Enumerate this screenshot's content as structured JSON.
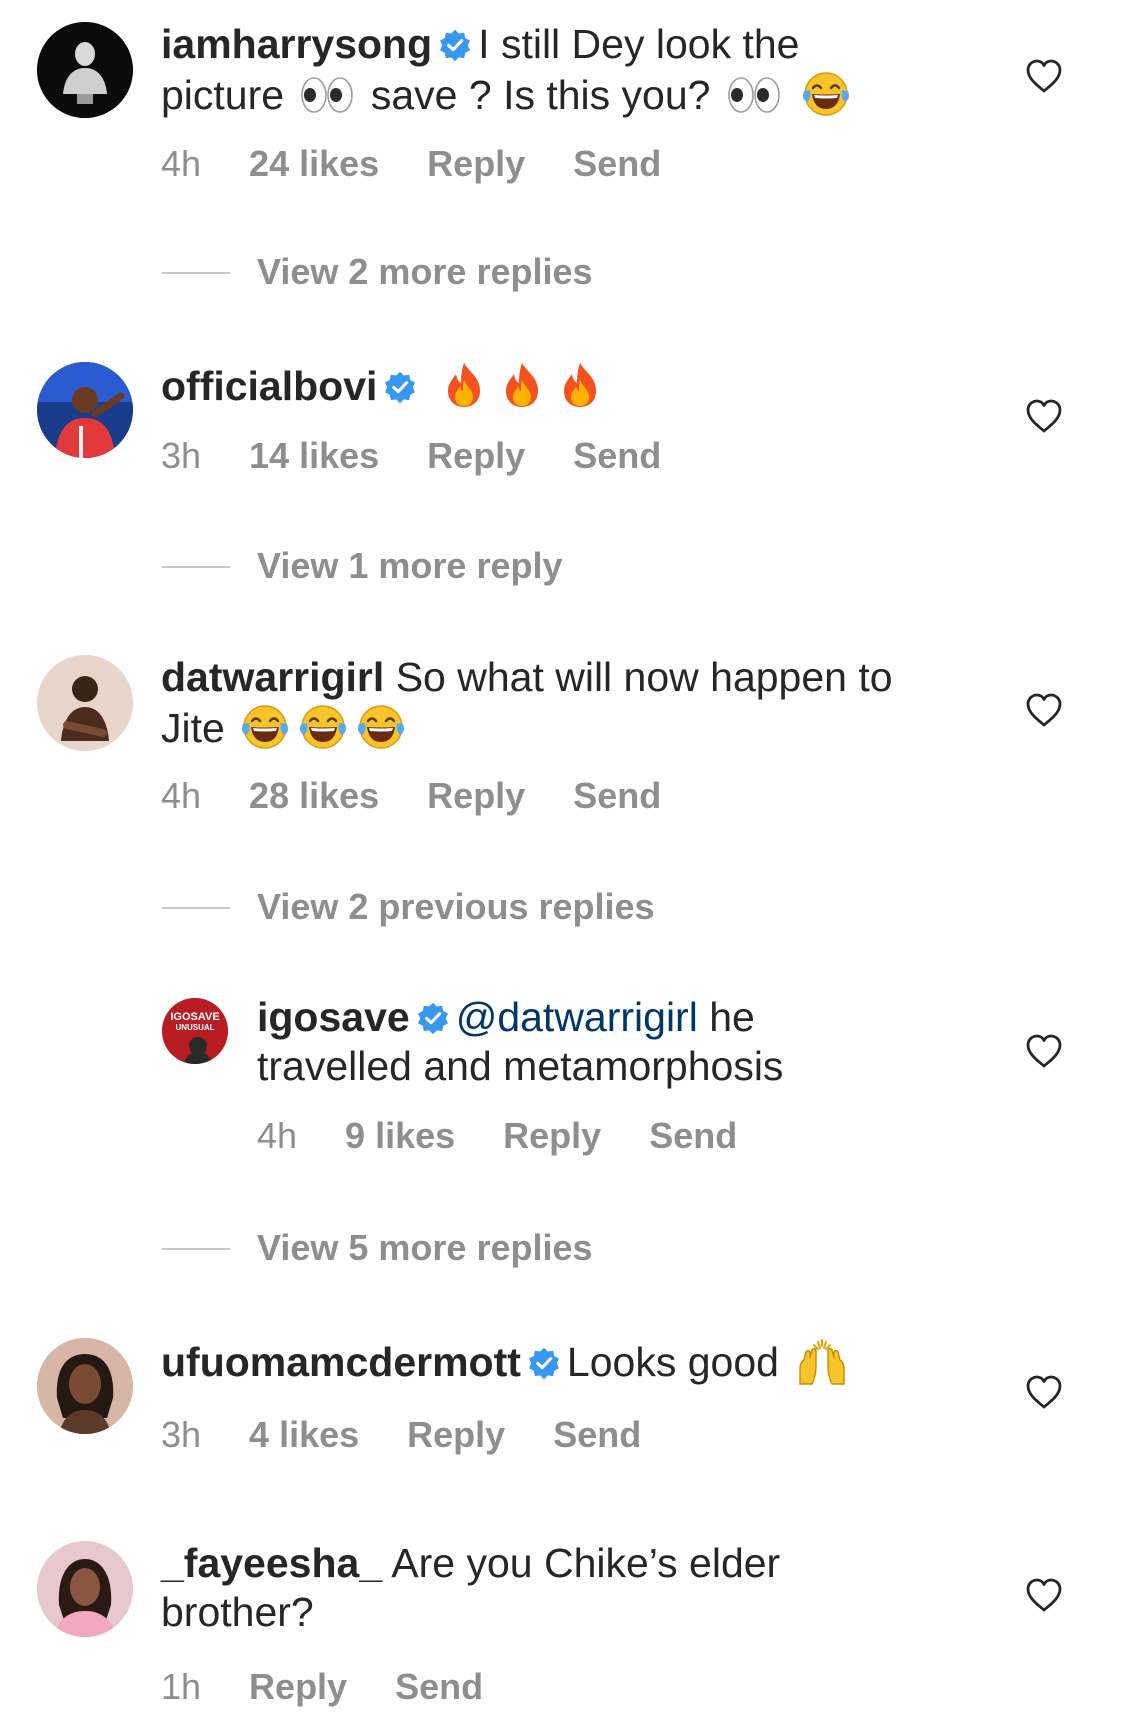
{
  "comments": [
    {
      "username": "iamharrysong",
      "verified": true,
      "text_a": "I still Dey look the",
      "text_b": "picture",
      "text_c": "save ? Is this you?",
      "time": "4h",
      "likes": "24 likes",
      "reply": "Reply",
      "send": "Send",
      "view_more": "View 2 more replies"
    },
    {
      "username": "officialbovi",
      "verified": true,
      "time": "3h",
      "likes": "14 likes",
      "reply": "Reply",
      "send": "Send",
      "view_more": "View 1 more reply"
    },
    {
      "username": "datwarrigirl",
      "verified": false,
      "text_a": "So what will now happen to",
      "text_b": "Jite",
      "time": "4h",
      "likes": "28 likes",
      "reply": "Reply",
      "send": "Send",
      "view_more": "View 2 previous replies"
    },
    {
      "username": "igosave",
      "verified": true,
      "mention": "@datwarrigirl",
      "text_a": "he",
      "text_b": "travelled and metamorphosis",
      "time": "4h",
      "likes": "9 likes",
      "reply": "Reply",
      "send": "Send",
      "view_more": "View 5 more replies",
      "avatar_text": "IGOSAVE",
      "avatar_subtext": "UNUSUAL"
    },
    {
      "username": "ufuomamcdermott",
      "verified": true,
      "text_a": "Looks good",
      "time": "3h",
      "likes": "4 likes",
      "reply": "Reply",
      "send": "Send"
    },
    {
      "username": "_fayeesha_",
      "verified": false,
      "text_a": "Are you Chike’s elder",
      "text_b": "brother?",
      "time": "1h",
      "reply": "Reply",
      "send": "Send"
    }
  ],
  "icons": {
    "verified": "verified-badge-icon",
    "heart": "heart-outline-icon",
    "eyes": "eyes-emoji",
    "laugh": "tears-of-joy-emoji",
    "fire": "fire-emoji",
    "hands": "raising-hands-emoji"
  },
  "colors": {
    "verified_blue": "#3897f0",
    "meta_gray": "#8e8e8e",
    "mention_blue": "#00376b"
  }
}
